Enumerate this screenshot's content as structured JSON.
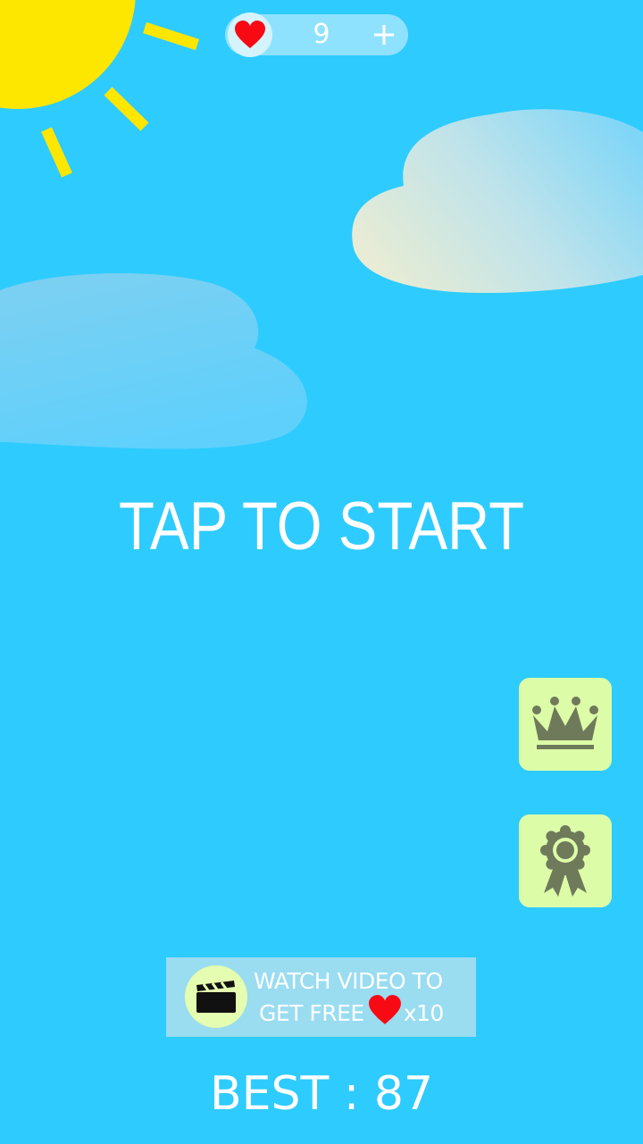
{
  "lives": {
    "count": "9",
    "add_label": "+"
  },
  "start": {
    "label": "TAP TO START"
  },
  "buttons": {
    "leaderboard_icon": "crown-icon",
    "achievements_icon": "award-ribbon-icon"
  },
  "reward": {
    "line1": "WATCH VIDEO TO",
    "line2": "GET FREE",
    "multiplier": "x10",
    "icon": "clapperboard-icon"
  },
  "best": {
    "label": "BEST",
    "separator": ":",
    "score": "87"
  },
  "colors": {
    "sky": "#2ecbfe",
    "sun": "#fde600",
    "heart": "#f80a14",
    "button_bg": "#dcfca8",
    "button_icon": "#6f7a5a",
    "banner_bg": "#9adcf0"
  }
}
